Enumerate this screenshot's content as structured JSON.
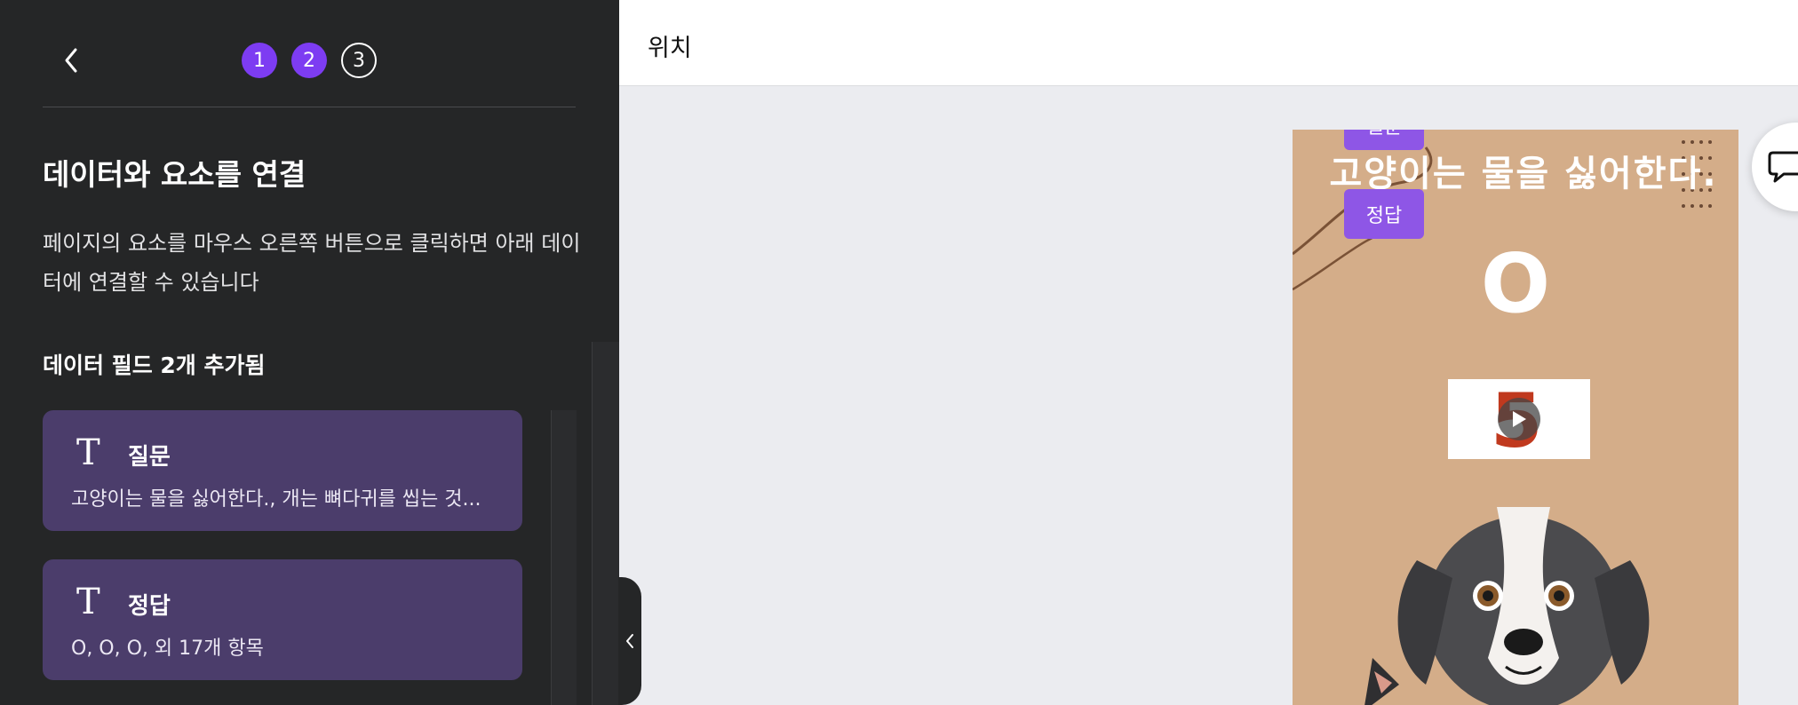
{
  "sidebar": {
    "steps": [
      "1",
      "2",
      "3"
    ],
    "title": "데이터와 요소를 연결",
    "description": "페이지의 요소를 마우스 오른쪽 버튼으로 클릭하면 아래 데이터에 연결할 수 있습니다",
    "fields_count": "데이터 필드 2개 추가됨",
    "fields": [
      {
        "type_icon": "T",
        "name": "질문",
        "value": "고양이는 물을 싫어한다., 개는 뼈다귀를 씹는 것..."
      },
      {
        "type_icon": "T",
        "name": "정답",
        "value": "O, O, O, 외 17개 항목"
      }
    ]
  },
  "header": {
    "title": "위치"
  },
  "canvas": {
    "heading": "고양이는 물을 싫어한다.",
    "answer": "O",
    "video_number": "5",
    "tags": [
      "질문",
      "정답"
    ],
    "background_color": "#d4ad89"
  },
  "colors": {
    "accent": "#7d3cf2",
    "card": "#4b3d6b",
    "tag": "#8e56e6",
    "panel": "#252627"
  }
}
